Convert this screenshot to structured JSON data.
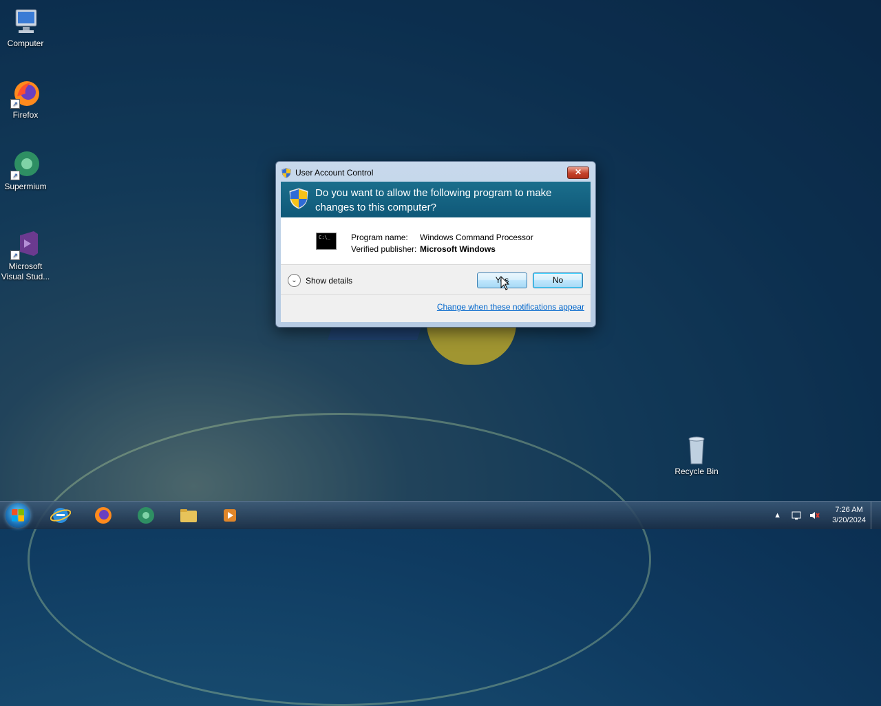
{
  "desktop": {
    "icons": [
      {
        "label": "Computer"
      },
      {
        "label": "Firefox"
      },
      {
        "label": "Supermium"
      },
      {
        "label": "Microsoft Visual Stud..."
      },
      {
        "label": "Recycle Bin"
      }
    ]
  },
  "dialog": {
    "title": "User Account Control",
    "close_symbol": "✕",
    "question": "Do you want to allow the following program to make changes to this computer?",
    "program_name_label": "Program name:",
    "program_name": "Windows Command Processor",
    "publisher_label": "Verified publisher:",
    "publisher": "Microsoft Windows",
    "cmd_icon_text": "C:\\_",
    "show_details": "Show details",
    "yes": "Yes",
    "no": "No",
    "link": "Change when these notifications appear"
  },
  "taskbar": {
    "pinned": [
      "internet-explorer-icon",
      "firefox-icon",
      "supermium-icon",
      "file-explorer-icon",
      "media-player-icon"
    ],
    "tray_arrow": "▲",
    "time": "7:26 AM",
    "date": "3/20/2024"
  },
  "colors": {
    "banner": "#1b6e8c",
    "link": "#0066cc",
    "close": "#c4412a"
  }
}
